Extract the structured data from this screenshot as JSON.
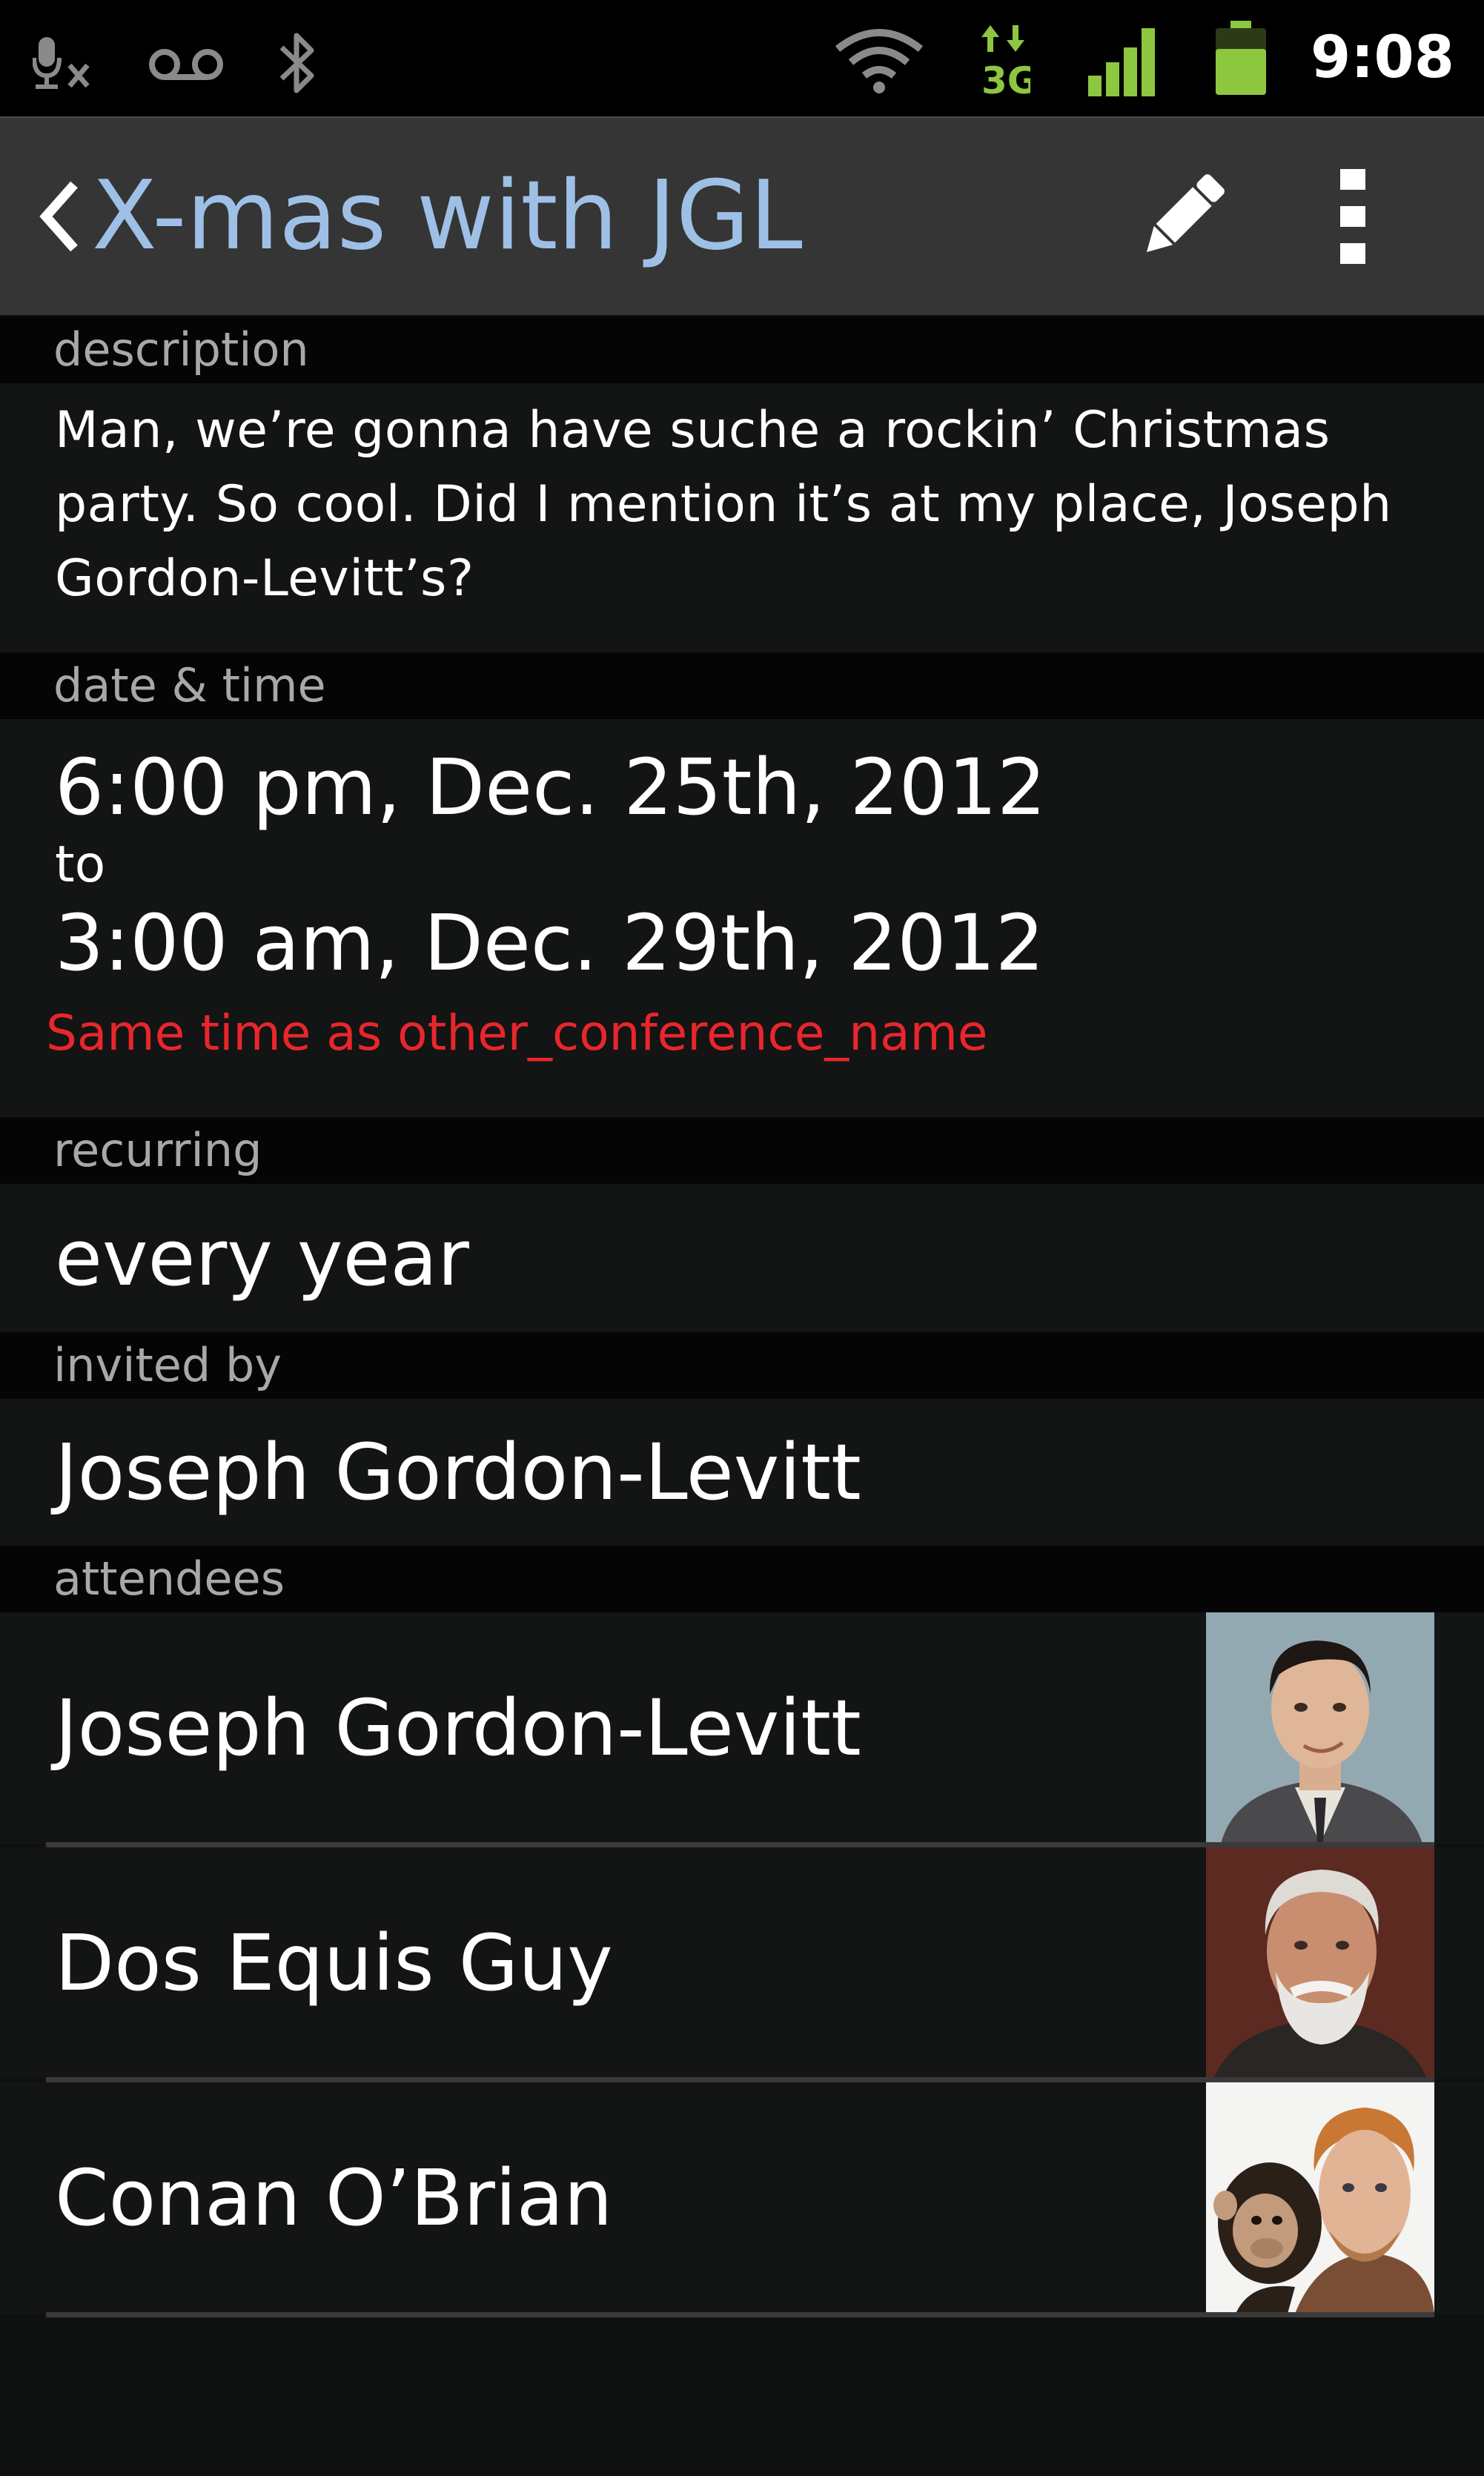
{
  "status_bar": {
    "time": "9:08",
    "network_label": "3G",
    "icons": [
      "mic-muted-icon",
      "voicemail-icon",
      "bluetooth-icon",
      "wifi-icon",
      "data-3g-icon",
      "signal-icon",
      "battery-icon"
    ],
    "accent_color": "#8dc63f"
  },
  "action_bar": {
    "title": "X-mas with JGL",
    "title_color": "#9ec0e6",
    "back_icon": "chevron-left-icon",
    "edit_icon": "pencil-icon",
    "overflow_icon": "overflow-menu-icon"
  },
  "description": {
    "header": "description",
    "text": "Man, we’re gonna have suche a rockin’ Christmas party. So cool. Did I mention it’s at my place, Joseph Gordon-Levitt’s?"
  },
  "date_time": {
    "header": "date & time",
    "start": "6:00 pm, Dec. 25th, 2012",
    "to_label": "to",
    "end": "3:00 am, Dec. 29th, 2012",
    "conflict": "Same time as other_conference_name",
    "conflict_color": "#e8262c"
  },
  "recurring": {
    "header": "recurring",
    "value": "every year"
  },
  "invited_by": {
    "header": "invited by",
    "value": "Joseph Gordon-Levitt"
  },
  "attendees": {
    "header": "attendees",
    "items": [
      {
        "name": "Joseph Gordon-Levitt",
        "photo": "avatar-joseph-gordon-levitt"
      },
      {
        "name": "Dos Equis Guy",
        "photo": "avatar-dos-equis-guy"
      },
      {
        "name": "Conan O’Brian",
        "photo": "avatar-conan-obrian"
      }
    ]
  }
}
